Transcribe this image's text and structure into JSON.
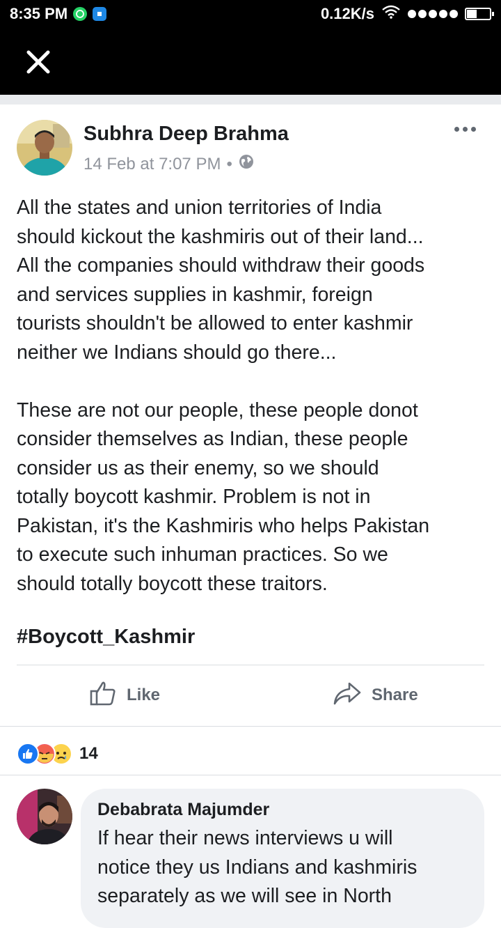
{
  "status_bar": {
    "time": "8:35 PM",
    "net_speed": "0.12K/s",
    "icons": [
      "whatsapp-icon",
      "app-notification-icon",
      "wifi-icon",
      "signal-icon",
      "battery-icon"
    ]
  },
  "header": {
    "close_icon": "close-icon"
  },
  "post": {
    "author": "Subhra Deep Brahma",
    "timestamp": "14 Feb at 7:07 PM",
    "separator": "•",
    "privacy_icon": "globe-icon",
    "more_icon": "more-options-icon",
    "body": "All the states and union territories of India\nshould kickout the kashmiris out of their land...\nAll the companies should withdraw their goods\nand services supplies in kashmir, foreign\ntourists shouldn't be allowed to enter kashmir\nneither we Indians should go there...\n\nThese are not our people, these people donot\nconsider themselves as Indian, these people\nconsider us as their enemy, so we should\ntotally boycott kashmir. Problem is not in\nPakistan, it's the Kashmiris who helps Pakistan\nto execute such inhuman practices. So we\nshould totally boycott these traitors.",
    "hashtag": "#Boycott_Kashmir"
  },
  "actions": {
    "like_label": "Like",
    "share_label": "Share"
  },
  "reactions": {
    "types": [
      "like",
      "angry",
      "sad"
    ],
    "count": "14",
    "colors": {
      "like": "#1877f2",
      "angry": "#f25268",
      "sad": "#fcd34d"
    }
  },
  "comment": {
    "author": "Debabrata Majumder",
    "text": "If hear their news interviews u will\nnotice they us Indians and kashmiris\nseparately as we will see in North"
  }
}
